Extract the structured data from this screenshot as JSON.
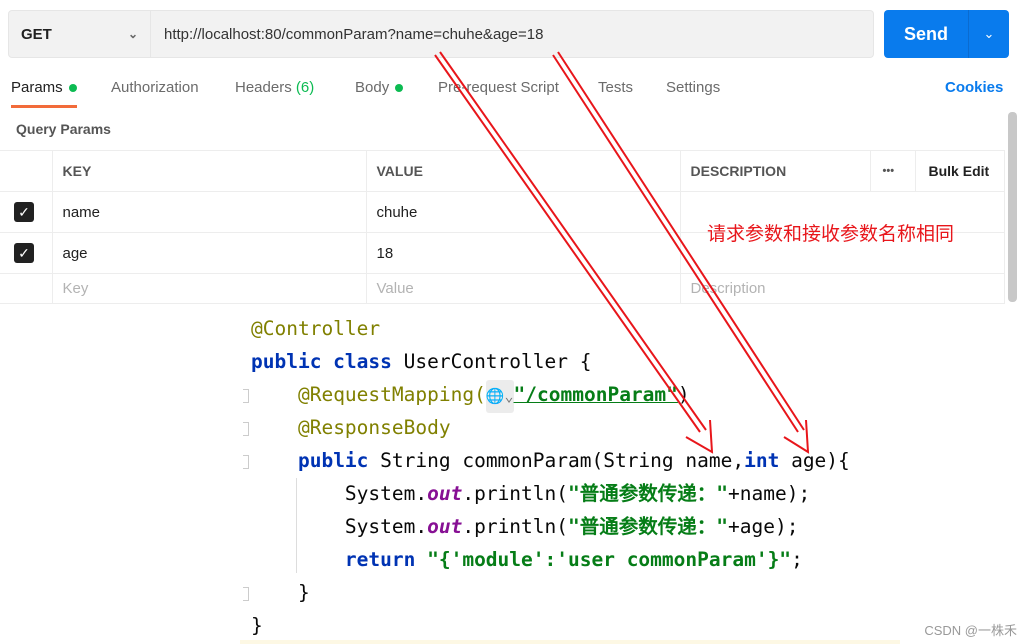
{
  "request": {
    "method": "GET",
    "url": "http://localhost:80/commonParam?name=chuhe&age=18",
    "send_label": "Send"
  },
  "tabs": [
    {
      "label": "Params",
      "dot": true
    },
    {
      "label": "Authorization"
    },
    {
      "label": "Headers",
      "count": "(6)"
    },
    {
      "label": "Body",
      "dot": true
    },
    {
      "label": "Pre-request Script"
    },
    {
      "label": "Tests"
    },
    {
      "label": "Settings"
    }
  ],
  "cookies_label": "Cookies",
  "query_params_title": "Query Params",
  "table": {
    "headers": [
      "KEY",
      "VALUE",
      "DESCRIPTION"
    ],
    "more": "•••",
    "bulk_edit": "Bulk Edit",
    "rows": [
      {
        "key": "name",
        "value": "chuhe",
        "checked": true
      },
      {
        "key": "age",
        "value": "18",
        "checked": true
      }
    ],
    "placeholders": {
      "key": "Key",
      "value": "Value",
      "description": "Description"
    }
  },
  "annotation": "请求参数和接收参数名称相同",
  "code": {
    "l1": "@Controller",
    "l2a": "public class ",
    "l2b": "UserController {",
    "l3a": "@RequestMapping(",
    "l3g": "🌐⌄",
    "l3b": "\"/commonParam\"",
    "l3c": ")",
    "l4": "@ResponseBody",
    "l5a": "public ",
    "l5b": "String commonParam(String name,",
    "l5c": "int ",
    "l5d": "age){",
    "p1": "System.",
    "out": "out",
    "p2": ".println(",
    "s1": "\"普通参数传递：\"",
    "e1": "+name);",
    "e2": "+age);",
    "ret": "return ",
    "rs": "\"{'module':'user commonParam'}\"",
    "semi": ";",
    "close1": "}",
    "close2": "}"
  },
  "watermark": "CSDN @一株禾",
  "colors": {
    "accent": "#097bed",
    "arrow": "#e8161b",
    "tab_underline": "#f26b3a",
    "dot": "#0cbb52"
  }
}
